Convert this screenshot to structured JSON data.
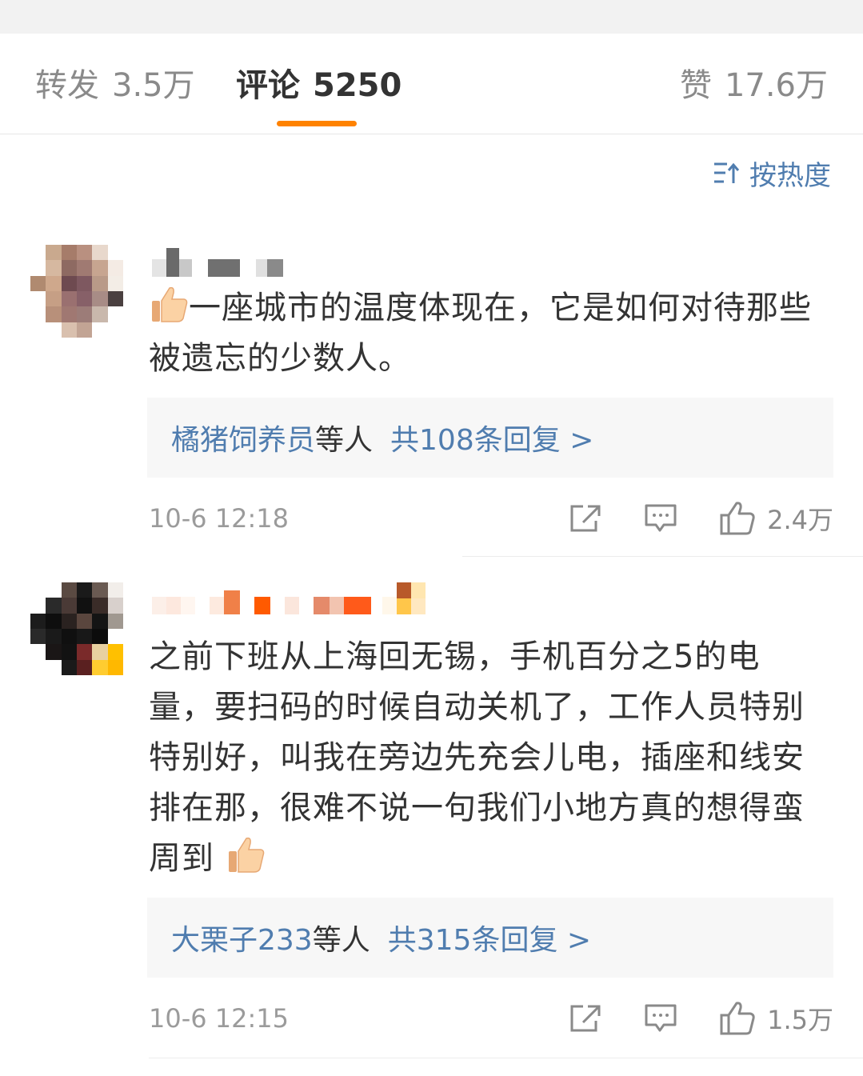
{
  "tabs": {
    "repost": {
      "label": "转发",
      "count": "3.5万"
    },
    "comments": {
      "label": "评论",
      "count": "5250"
    },
    "likes": {
      "label": "赞",
      "count": "17.6万"
    }
  },
  "sort": {
    "label": "按热度",
    "icon": "sort-icon"
  },
  "colors": {
    "accent": "#ff8200",
    "link": "#507daf",
    "muted": "#9b9b9b",
    "text": "#333333"
  },
  "comments": [
    {
      "text_prefix_emoji": "thumbs-up",
      "text": "一座城市的温度体现在，它是如何对待那些被遗忘的少数人。",
      "replies": {
        "names": "橘猪饲养员",
        "others": "等人",
        "total": "共108条回复 >"
      },
      "time": "10-6 12:18",
      "likes": "2.4万"
    },
    {
      "text": "之前下班从上海回无锡，手机百分之5的电量，要扫码的时候自动关机了，工作人员特别特别好，叫我在旁边先充会儿电，插座和线安排在那，很难不说一句我们小地方真的想得蛮周到",
      "text_suffix_emoji": "thumbs-up",
      "replies": {
        "names": "大栗子233",
        "others": "等人",
        "total": "共315条回复 >"
      },
      "time": "10-6 12:15",
      "likes": "1.5万"
    }
  ]
}
